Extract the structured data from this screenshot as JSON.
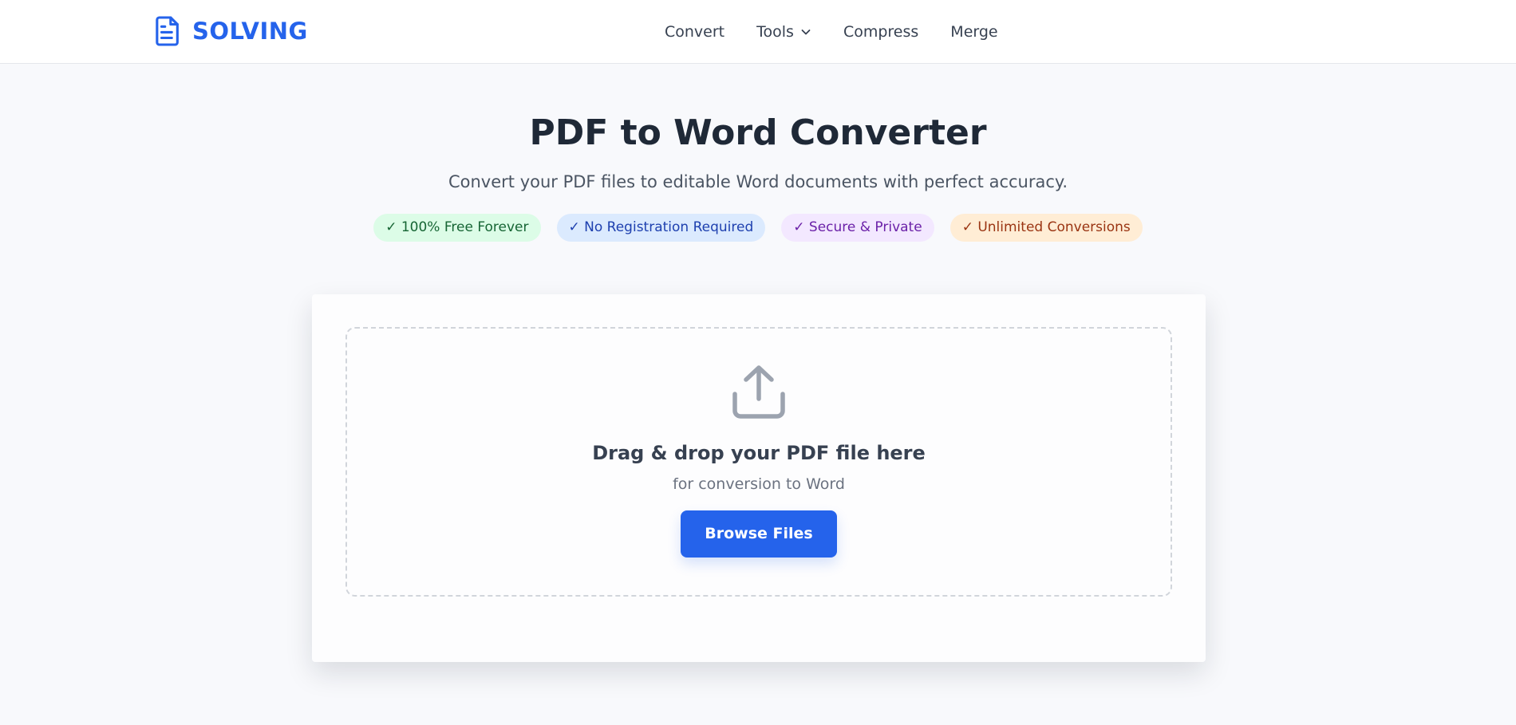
{
  "brand": {
    "name": "SOLVING",
    "color": "#2563eb",
    "icon": "document-icon"
  },
  "nav": {
    "items": [
      {
        "label": "Convert"
      },
      {
        "label": "Tools",
        "icon": "chevron-down-icon"
      },
      {
        "label": "Compress"
      },
      {
        "label": "Merge"
      }
    ]
  },
  "hero": {
    "title": "PDF to Word Converter",
    "subtitle": "Convert your PDF files to editable Word documents with perfect accuracy.",
    "badges": [
      {
        "label": "✓ 100% Free Forever",
        "color": "#166534"
      },
      {
        "label": "✓ No Registration Required",
        "color": "#1e40af"
      },
      {
        "label": "✓ Secure & Private",
        "color": "#6b21a8"
      },
      {
        "label": "✓ Unlimited Conversions",
        "color": "#9a3412"
      }
    ]
  },
  "dropzone": {
    "icon": "upload-icon",
    "title": "Drag & drop your PDF file here",
    "subtitle": "for conversion to Word",
    "button_label": "Browse Files",
    "button_color": "#2563eb"
  }
}
